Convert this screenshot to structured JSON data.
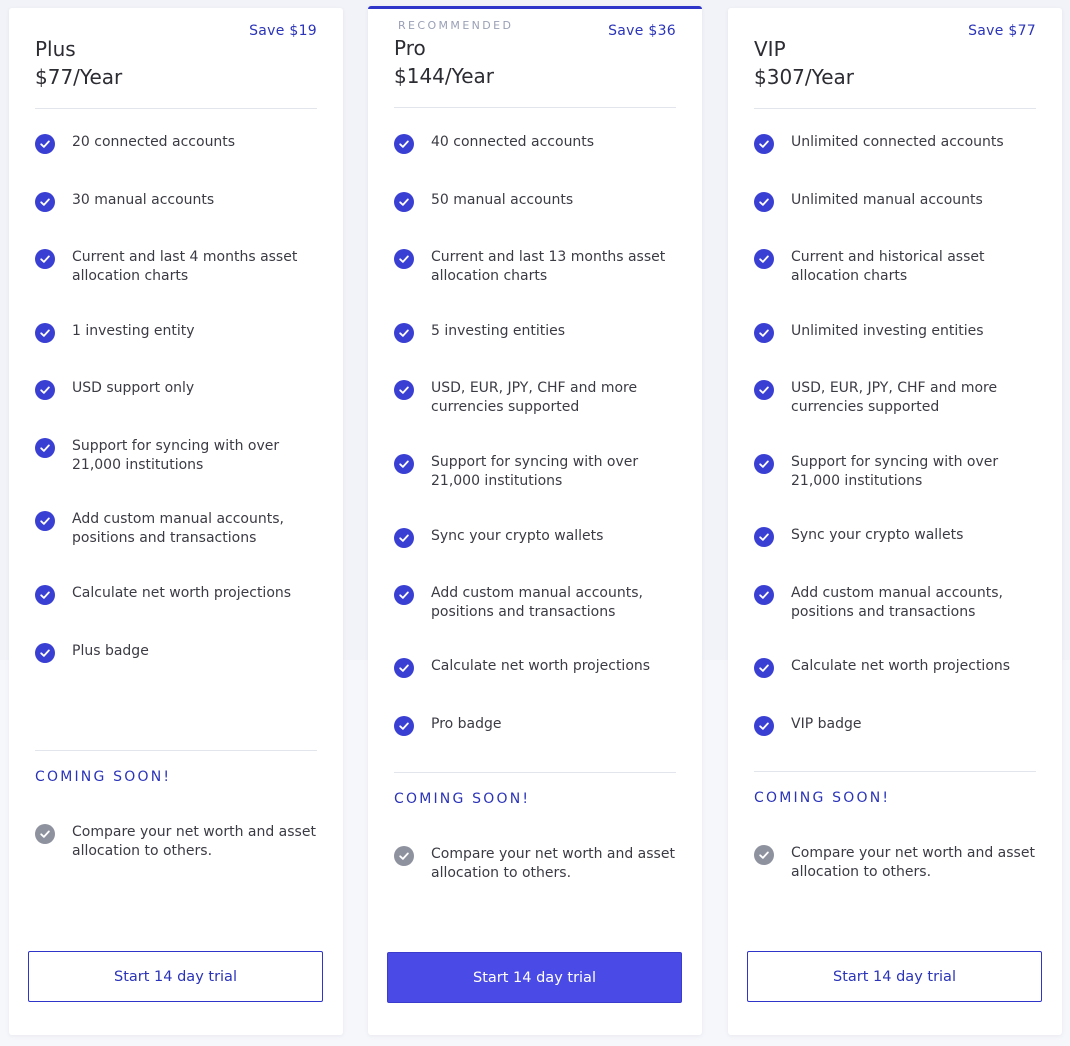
{
  "colors": {
    "accent": "#2b34b8",
    "check": "#3a3fd4",
    "check_disabled": "#8e929f",
    "primary_button": "#4a4ae6"
  },
  "plans": [
    {
      "name": "Plus",
      "price": "$77/Year",
      "save": "Save $19",
      "features": [
        "20 connected accounts",
        "30 manual accounts",
        "Current and last 4 months asset allocation charts",
        "1 investing entity",
        "USD support only",
        "Support for syncing with over 21,000 institutions",
        "Add custom manual accounts, positions and transactions",
        "Calculate net worth projections",
        "Plus badge"
      ],
      "coming_soon_label": "COMING SOON!",
      "coming_soon": [
        "Compare your net worth and asset allocation to others."
      ],
      "cta": "Start 14 day trial"
    },
    {
      "name": "Pro",
      "price": "$144/Year",
      "save": "Save $36",
      "badge": "RECOMMENDED",
      "features": [
        "40 connected accounts",
        "50 manual accounts",
        "Current and last 13 months asset allocation charts",
        "5 investing entities",
        "USD, EUR, JPY, CHF and more currencies supported",
        "Support for syncing with over 21,000 institutions",
        "Sync your crypto wallets",
        "Add custom manual accounts, positions and transactions",
        "Calculate net worth projections",
        "Pro badge"
      ],
      "coming_soon_label": "COMING SOON!",
      "coming_soon": [
        "Compare your net worth and asset allocation to others."
      ],
      "cta": "Start 14 day trial"
    },
    {
      "name": "VIP",
      "price": "$307/Year",
      "save": "Save $77",
      "features": [
        "Unlimited connected accounts",
        "Unlimited manual accounts",
        "Current and historical asset allocation charts",
        "Unlimited investing entities",
        "USD, EUR, JPY, CHF and more currencies supported",
        "Support for syncing with over 21,000 institutions",
        "Sync your crypto wallets",
        "Add custom manual accounts, positions and transactions",
        "Calculate net worth projections",
        "VIP badge"
      ],
      "coming_soon_label": "COMING SOON!",
      "coming_soon": [
        "Compare your net worth and asset allocation to others."
      ],
      "cta": "Start 14 day trial"
    }
  ]
}
